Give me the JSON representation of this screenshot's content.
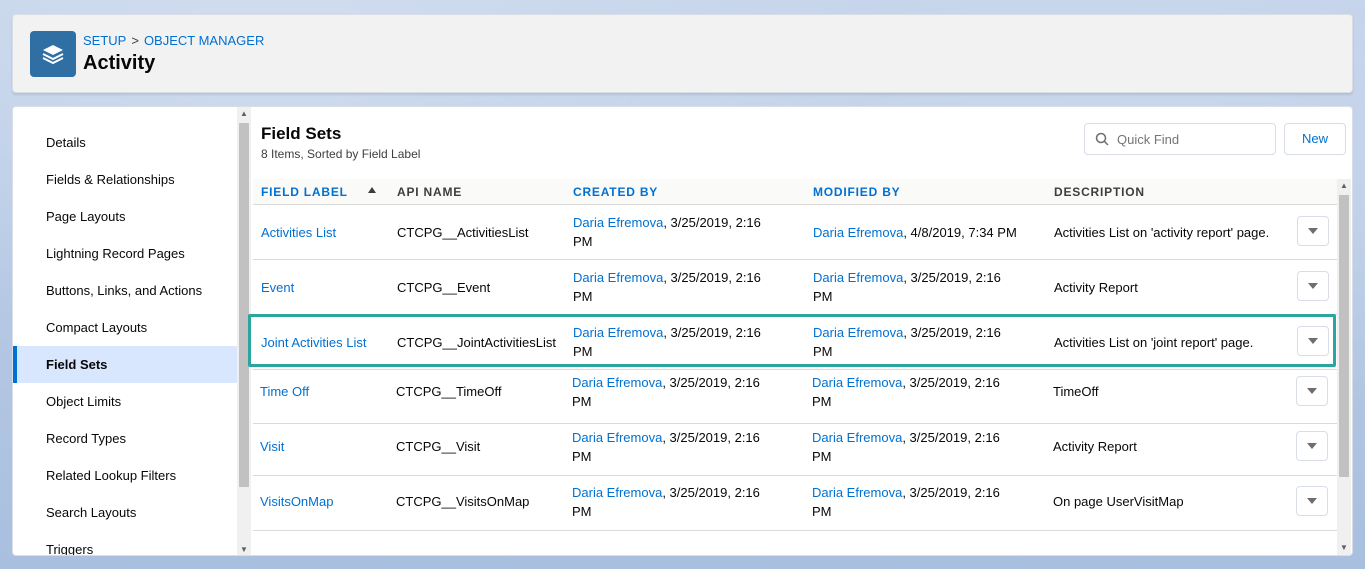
{
  "header": {
    "breadcrumb": [
      "SETUP",
      ">",
      "OBJECT MANAGER"
    ],
    "title": "Activity",
    "icon": "stack-layers-icon"
  },
  "sidebar": {
    "items": [
      {
        "label": "Details",
        "active": false
      },
      {
        "label": "Fields & Relationships",
        "active": false
      },
      {
        "label": "Page Layouts",
        "active": false
      },
      {
        "label": "Lightning Record Pages",
        "active": false
      },
      {
        "label": "Buttons, Links, and Actions",
        "active": false
      },
      {
        "label": "Compact Layouts",
        "active": false
      },
      {
        "label": "Field Sets",
        "active": true
      },
      {
        "label": "Object Limits",
        "active": false
      },
      {
        "label": "Record Types",
        "active": false
      },
      {
        "label": "Related Lookup Filters",
        "active": false
      },
      {
        "label": "Search Layouts",
        "active": false
      },
      {
        "label": "Triggers",
        "active": false
      }
    ]
  },
  "main": {
    "title": "Field Sets",
    "subtitle": "8 Items, Sorted by Field Label",
    "search": {
      "placeholder": "Quick Find",
      "value": ""
    },
    "new_label": "New",
    "columns": [
      "FIELD LABEL",
      "API NAME",
      "CREATED BY",
      "MODIFIED BY",
      "DESCRIPTION"
    ],
    "rows": [
      {
        "label": "Activities List",
        "api": "CTCPG__ActivitiesList",
        "created_by": "Daria Efremova",
        "created_at": ", 3/25/2019, 2:16",
        "created_at2": "PM",
        "modified_by": "Daria Efremova",
        "modified_at": ", 4/8/2019, 7:34 PM",
        "modified_at2": "",
        "description": "Activities List on 'activity report' page.",
        "highlighted": false
      },
      {
        "label": "Event",
        "api": "CTCPG__Event",
        "created_by": "Daria Efremova",
        "created_at": ", 3/25/2019, 2:16",
        "created_at2": "PM",
        "modified_by": "Daria Efremova",
        "modified_at": ", 3/25/2019, 2:16",
        "modified_at2": "PM",
        "description": "Activity Report",
        "highlighted": false
      },
      {
        "label": "Joint Activities List",
        "api": "CTCPG__JointActivitiesList",
        "created_by": "Daria Efremova",
        "created_at": ", 3/25/2019, 2:16",
        "created_at2": "PM",
        "modified_by": "Daria Efremova",
        "modified_at": ", 3/25/2019, 2:16",
        "modified_at2": "PM",
        "description": "Activities List on 'joint report' page.",
        "highlighted": true
      },
      {
        "label": "Time Off",
        "api": "CTCPG__TimeOff",
        "created_by": "Daria Efremova",
        "created_at": ", 3/25/2019, 2:16",
        "created_at2": "PM",
        "modified_by": "Daria Efremova",
        "modified_at": ", 3/25/2019, 2:16",
        "modified_at2": "PM",
        "description": "TimeOff",
        "highlighted": false
      },
      {
        "label": "Visit",
        "api": "CTCPG__Visit",
        "created_by": "Daria Efremova",
        "created_at": ", 3/25/2019, 2:16",
        "created_at2": "PM",
        "modified_by": "Daria Efremova",
        "modified_at": ", 3/25/2019, 2:16",
        "modified_at2": "PM",
        "description": "Activity Report",
        "highlighted": false
      },
      {
        "label": "VisitsOnMap",
        "api": "CTCPG__VisitsOnMap",
        "created_by": "Daria Efremova",
        "created_at": ", 3/25/2019, 2:16",
        "created_at2": "PM",
        "modified_by": "Daria Efremova",
        "modified_at": ", 3/25/2019, 2:16",
        "modified_at2": "PM",
        "description": "On page UserVisitMap",
        "highlighted": false
      }
    ]
  },
  "colors": {
    "link": "#0070d2",
    "active_bg": "#d8e6fe",
    "highlight": "#2ba59f",
    "icon_bg": "#2f6fa4"
  }
}
